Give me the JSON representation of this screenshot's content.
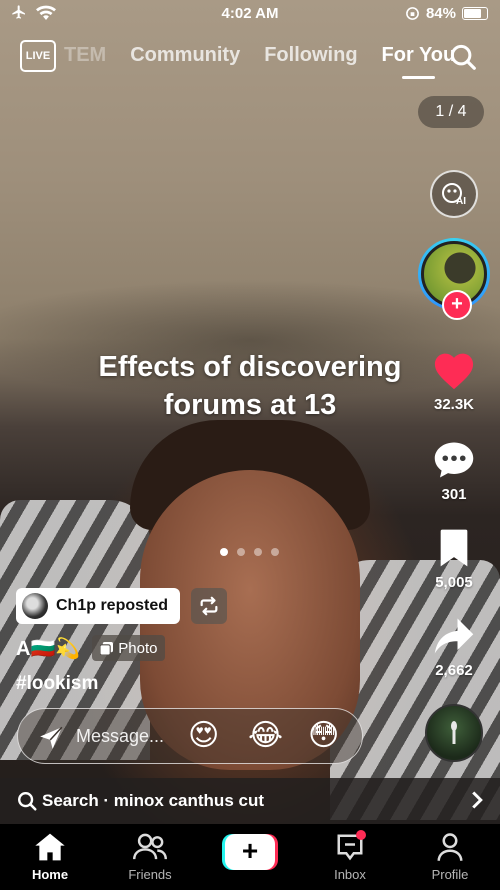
{
  "status_bar": {
    "time": "4:02 AM",
    "battery": "84%"
  },
  "top_nav": {
    "live_label": "LIVE",
    "tabs": [
      "TEM",
      "Community",
      "Following",
      "For You"
    ],
    "active_tab": "For You"
  },
  "page_counter": "1 / 4",
  "rail": {
    "ai_label": "AI",
    "likes": "32.3K",
    "comments": "301",
    "saves": "5,005",
    "shares": "2,662"
  },
  "caption_overlay": [
    "Effects of discovering",
    "forums at 13"
  ],
  "repost": {
    "text": "Ch1p reposted"
  },
  "author": {
    "name": "A🇧🇬💫",
    "badge": "Photo"
  },
  "hashtag": "#lookism",
  "message": {
    "placeholder": "Message...",
    "emojis": [
      "😍",
      "😂",
      "😳"
    ]
  },
  "search_suggestion": {
    "prefix": "Search",
    "query": "minox canthus cut",
    "text": "Search · minox canthus cut"
  },
  "bottom_nav": {
    "home": "Home",
    "friends": "Friends",
    "inbox": "Inbox",
    "profile": "Profile"
  },
  "colors": {
    "like": "#fe2c55",
    "accent_cyan": "#25f4ee",
    "accent_pink": "#fe2c55"
  },
  "icons": [
    "airplane-icon",
    "wifi-icon",
    "live-icon",
    "search-icon",
    "ai-icon",
    "heart-icon",
    "comment-icon",
    "bookmark-icon",
    "share-icon",
    "repost-icon",
    "photo-icon",
    "send-icon",
    "chevron-right-icon",
    "home-icon",
    "friends-icon",
    "plus-icon",
    "inbox-icon",
    "profile-icon"
  ]
}
